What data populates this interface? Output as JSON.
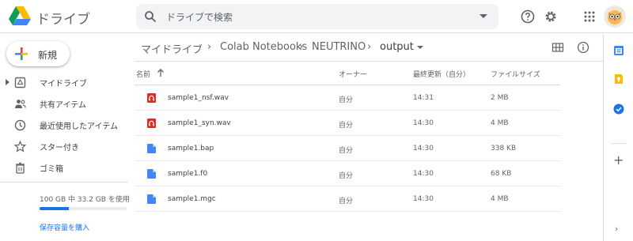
{
  "header": {
    "app_name": "ドライブ",
    "search_placeholder": "ドライブで検索"
  },
  "sidebar": {
    "new_label": "新規",
    "items": [
      {
        "label": "マイドライブ",
        "icon": "my-drive-icon"
      },
      {
        "label": "共有アイテム",
        "icon": "shared-icon"
      },
      {
        "label": "最近使用したアイテム",
        "icon": "recent-icon"
      },
      {
        "label": "スター付き",
        "icon": "star-icon"
      },
      {
        "label": "ゴミ箱",
        "icon": "trash-icon"
      }
    ],
    "storage_text": "100 GB 中 33.2 GB を使用",
    "storage_used_fraction": 0.332,
    "buy_storage": "保存容量を購入"
  },
  "breadcrumb": {
    "items": [
      "マイドライブ",
      "Colab Notebooks",
      "NEUTRINO",
      "output"
    ],
    "separator": "›"
  },
  "table": {
    "columns": {
      "name": "名前",
      "owner": "オーナー",
      "modified": "最終更新（自分）",
      "size": "ファイルサイズ"
    },
    "rows": [
      {
        "name": "sample1_nsf.wav",
        "owner": "自分",
        "modified": "14:31",
        "size": "2 MB",
        "type": "audio"
      },
      {
        "name": "sample1_syn.wav",
        "owner": "自分",
        "modified": "14:30",
        "size": "4 MB",
        "type": "audio"
      },
      {
        "name": "sample1.bap",
        "owner": "自分",
        "modified": "14:30",
        "size": "338 KB",
        "type": "doc"
      },
      {
        "name": "sample1.f0",
        "owner": "自分",
        "modified": "14:30",
        "size": "68 KB",
        "type": "doc"
      },
      {
        "name": "sample1.mgc",
        "owner": "自分",
        "modified": "14:30",
        "size": "4 MB",
        "type": "doc"
      }
    ]
  },
  "colors": {
    "accent": "#1a73e8",
    "audio_icon": "#d93025",
    "doc_icon": "#4285f4"
  }
}
